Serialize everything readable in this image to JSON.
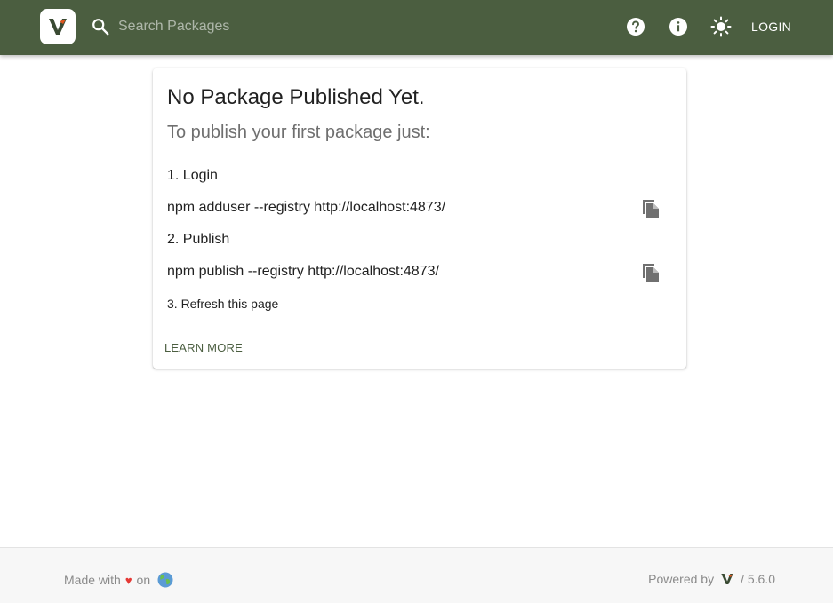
{
  "header": {
    "search_placeholder": "Search Packages",
    "login_label": "LOGIN",
    "icons": [
      "verdaccio-logo-icon",
      "search-icon",
      "help-icon",
      "info-icon",
      "theme-sun-icon"
    ],
    "background_color": "#4b5e40"
  },
  "card": {
    "title": "No Package Published Yet.",
    "subtitle": "To publish your first package just:",
    "step1": "1. Login",
    "command1": "npm adduser --registry http://localhost:4873/",
    "step2": "2. Publish",
    "command2": "npm publish --registry http://localhost:4873/",
    "step3": "3. Refresh this page",
    "learn_more": "LEARN MORE",
    "icons": [
      "copy-icon"
    ]
  },
  "footer": {
    "made_with": "Made with",
    "heart": "♥",
    "on": "on",
    "powered_by": "Powered by",
    "version": "/ 5.6.0",
    "icons": [
      "earth-globe-icon",
      "verdaccio-logo-icon"
    ]
  }
}
